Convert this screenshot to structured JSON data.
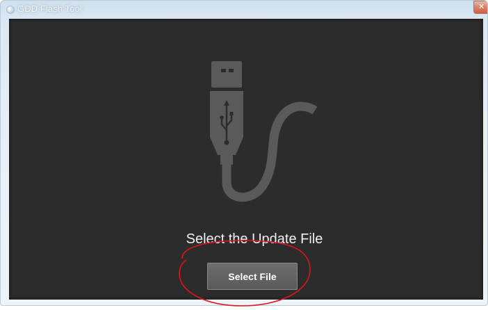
{
  "window": {
    "title": "GDD Flash Tool",
    "close_icon": "close-icon",
    "app_icon": "app-icon"
  },
  "main": {
    "illustration_icon": "usb-cable-icon",
    "prompt": "Select the Update File",
    "select_button_label": "Select File"
  },
  "colors": {
    "client_background": "#2c2c2c",
    "illustration": "#5a5a5a",
    "button_background": "#636363",
    "annotation_circle": "#e0141c"
  }
}
